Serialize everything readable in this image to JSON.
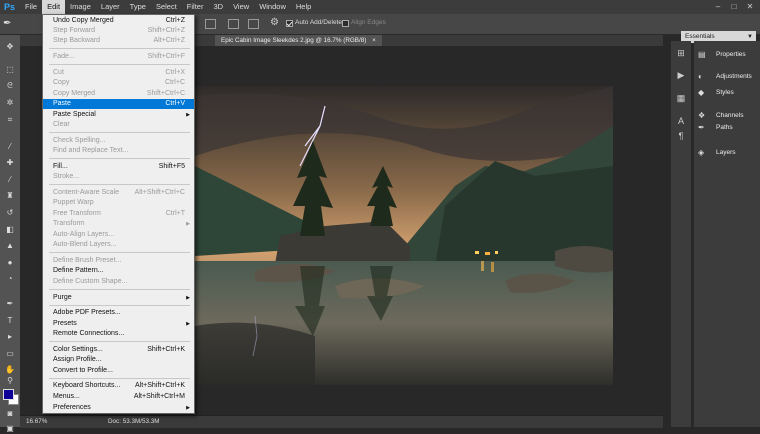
{
  "app": {
    "logo": "Ps"
  },
  "menubar": {
    "items": [
      "File",
      "Edit",
      "Image",
      "Layer",
      "Type",
      "Select",
      "Filter",
      "3D",
      "View",
      "Window",
      "Help"
    ]
  },
  "window_controls": [
    "–",
    "□",
    "✕"
  ],
  "options_bar": {
    "auto_add_delete": "Auto Add/Delete",
    "align_edges": "Align Edges",
    "auto_add_delete_checked": true,
    "align_edges_checked": false
  },
  "workspace": {
    "value": "Essentials"
  },
  "document": {
    "tab_title": "Epic Cabin Image Sleekdes 2.jpg @ 16.7% (RGB/8)",
    "close": "×"
  },
  "status": {
    "zoom": "16.67%",
    "doc_size": "Doc: 53.3M/53.3M"
  },
  "panels": [
    {
      "label": "Properties",
      "icon": "properties-icon"
    },
    {
      "label": "Adjustments",
      "icon": "adjustments-icon"
    },
    {
      "label": "Styles",
      "icon": "styles-icon"
    },
    {
      "label": "Channels",
      "icon": "channels-icon"
    },
    {
      "label": "Paths",
      "icon": "paths-icon"
    },
    {
      "label": "Layers",
      "icon": "layers-icon"
    }
  ],
  "colors": {
    "foreground": "#0e0096",
    "background": "#ffffff",
    "highlight": "#0078d7"
  },
  "edit_menu": {
    "items": [
      {
        "label": "Undo Copy Merged",
        "shortcut": "Ctrl+Z"
      },
      {
        "label": "Step Forward",
        "shortcut": "Shift+Ctrl+Z",
        "disabled": true
      },
      {
        "label": "Step Backward",
        "shortcut": "Alt+Ctrl+Z",
        "disabled": true
      },
      {
        "label": "Fade...",
        "shortcut": "Shift+Ctrl+F",
        "disabled": true
      },
      {
        "label": "Cut",
        "shortcut": "Ctrl+X",
        "disabled": true
      },
      {
        "label": "Copy",
        "shortcut": "Ctrl+C",
        "disabled": true
      },
      {
        "label": "Copy Merged",
        "shortcut": "Shift+Ctrl+C",
        "disabled": true
      },
      {
        "label": "Paste",
        "shortcut": "Ctrl+V",
        "highlighted": true
      },
      {
        "label": "Paste Special",
        "submenu": true
      },
      {
        "label": "Clear",
        "disabled": true
      },
      {
        "label": "Check Spelling...",
        "disabled": true
      },
      {
        "label": "Find and Replace Text...",
        "disabled": true
      },
      {
        "label": "Fill...",
        "shortcut": "Shift+F5"
      },
      {
        "label": "Stroke...",
        "disabled": true
      },
      {
        "label": "Content-Aware Scale",
        "shortcut": "Alt+Shift+Ctrl+C",
        "disabled": true
      },
      {
        "label": "Puppet Warp",
        "disabled": true
      },
      {
        "label": "Free Transform",
        "shortcut": "Ctrl+T",
        "disabled": true
      },
      {
        "label": "Transform",
        "submenu": true,
        "disabled": true
      },
      {
        "label": "Auto-Align Layers...",
        "disabled": true
      },
      {
        "label": "Auto-Blend Layers...",
        "disabled": true
      },
      {
        "label": "Define Brush Preset...",
        "disabled": true
      },
      {
        "label": "Define Pattern..."
      },
      {
        "label": "Define Custom Shape...",
        "disabled": true
      },
      {
        "label": "Purge",
        "submenu": true
      },
      {
        "label": "Adobe PDF Presets..."
      },
      {
        "label": "Presets",
        "submenu": true
      },
      {
        "label": "Remote Connections..."
      },
      {
        "label": "Color Settings...",
        "shortcut": "Shift+Ctrl+K"
      },
      {
        "label": "Assign Profile..."
      },
      {
        "label": "Convert to Profile..."
      },
      {
        "label": "Keyboard Shortcuts...",
        "shortcut": "Alt+Shift+Ctrl+K"
      },
      {
        "label": "Menus...",
        "shortcut": "Alt+Shift+Ctrl+M"
      },
      {
        "label": "Preferences",
        "submenu": true
      }
    ]
  }
}
